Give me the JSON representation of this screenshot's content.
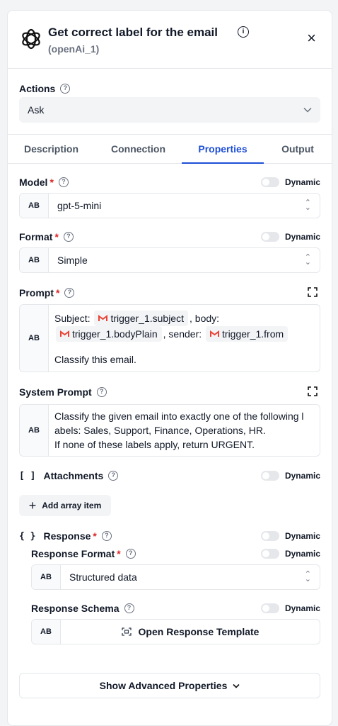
{
  "header": {
    "title": "Get correct label for the email",
    "subtitle": "(openAi_1)"
  },
  "actions": {
    "label": "Actions",
    "value": "Ask"
  },
  "tabs": [
    "Description",
    "Connection",
    "Properties",
    "Output"
  ],
  "active_tab": "Properties",
  "dynamic_label": "Dynamic",
  "model": {
    "label": "Model",
    "value": "gpt-5-mini",
    "type_badge": "AB"
  },
  "format": {
    "label": "Format",
    "value": "Simple",
    "type_badge": "AB"
  },
  "prompt": {
    "label": "Prompt",
    "type_badge": "AB",
    "text_subject": "Subject:",
    "chip_subject": "trigger_1.subject",
    "text_body": ", body:",
    "chip_body": "trigger_1.bodyPlain",
    "text_sender": ", sender:",
    "chip_from": "trigger_1.from",
    "line_2": "Classify this email."
  },
  "system_prompt": {
    "label": "System Prompt",
    "type_badge": "AB",
    "line_1": "Classify the given email into exactly one of the following l",
    "line_2": "abels: Sales, Support, Finance, Operations, HR.",
    "line_3": "If none of these labels apply, return URGENT."
  },
  "attachments": {
    "bracket": "[ ]",
    "label": "Attachments",
    "add_button": "Add array item"
  },
  "response": {
    "bracket": "{ }",
    "label": "Response",
    "format_label": "Response Format",
    "format_value": "Structured data",
    "schema_label": "Response Schema",
    "schema_button": "Open Response Template",
    "type_badge": "AB"
  },
  "advanced_button": "Show Advanced Properties",
  "colors": {
    "accent": "#1d4ed8",
    "required": "#dc2626",
    "gmail_red": "#ea4335"
  }
}
